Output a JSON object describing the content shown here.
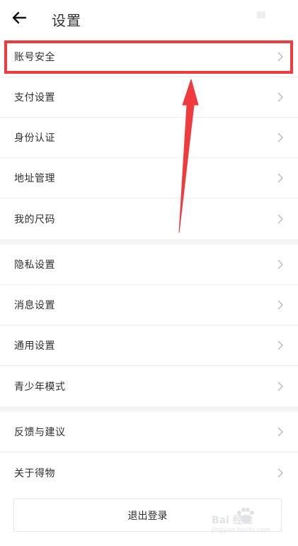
{
  "header": {
    "title": "设置",
    "back_icon": "arrow-left-icon"
  },
  "group1": {
    "items": [
      {
        "label": "账号安全"
      },
      {
        "label": "支付设置"
      },
      {
        "label": "身份认证"
      },
      {
        "label": "地址管理"
      },
      {
        "label": "我的尺码"
      }
    ]
  },
  "group2": {
    "items": [
      {
        "label": "隐私设置"
      },
      {
        "label": "消息设置"
      },
      {
        "label": "通用设置"
      },
      {
        "label": "青少年模式"
      }
    ]
  },
  "group3": {
    "items": [
      {
        "label": "反馈与建议"
      },
      {
        "label": "关于得物"
      }
    ]
  },
  "logout": {
    "label": "退出登录"
  },
  "annotation": {
    "color": "#ef3b3e"
  },
  "watermark": {
    "text": "Bai 经验",
    "sub": "jingyan.baidu.com"
  },
  "colors": {
    "divider": "#f0f0f2",
    "group_gap": "#f5f5f7",
    "chevron": "#b8b8bd"
  }
}
